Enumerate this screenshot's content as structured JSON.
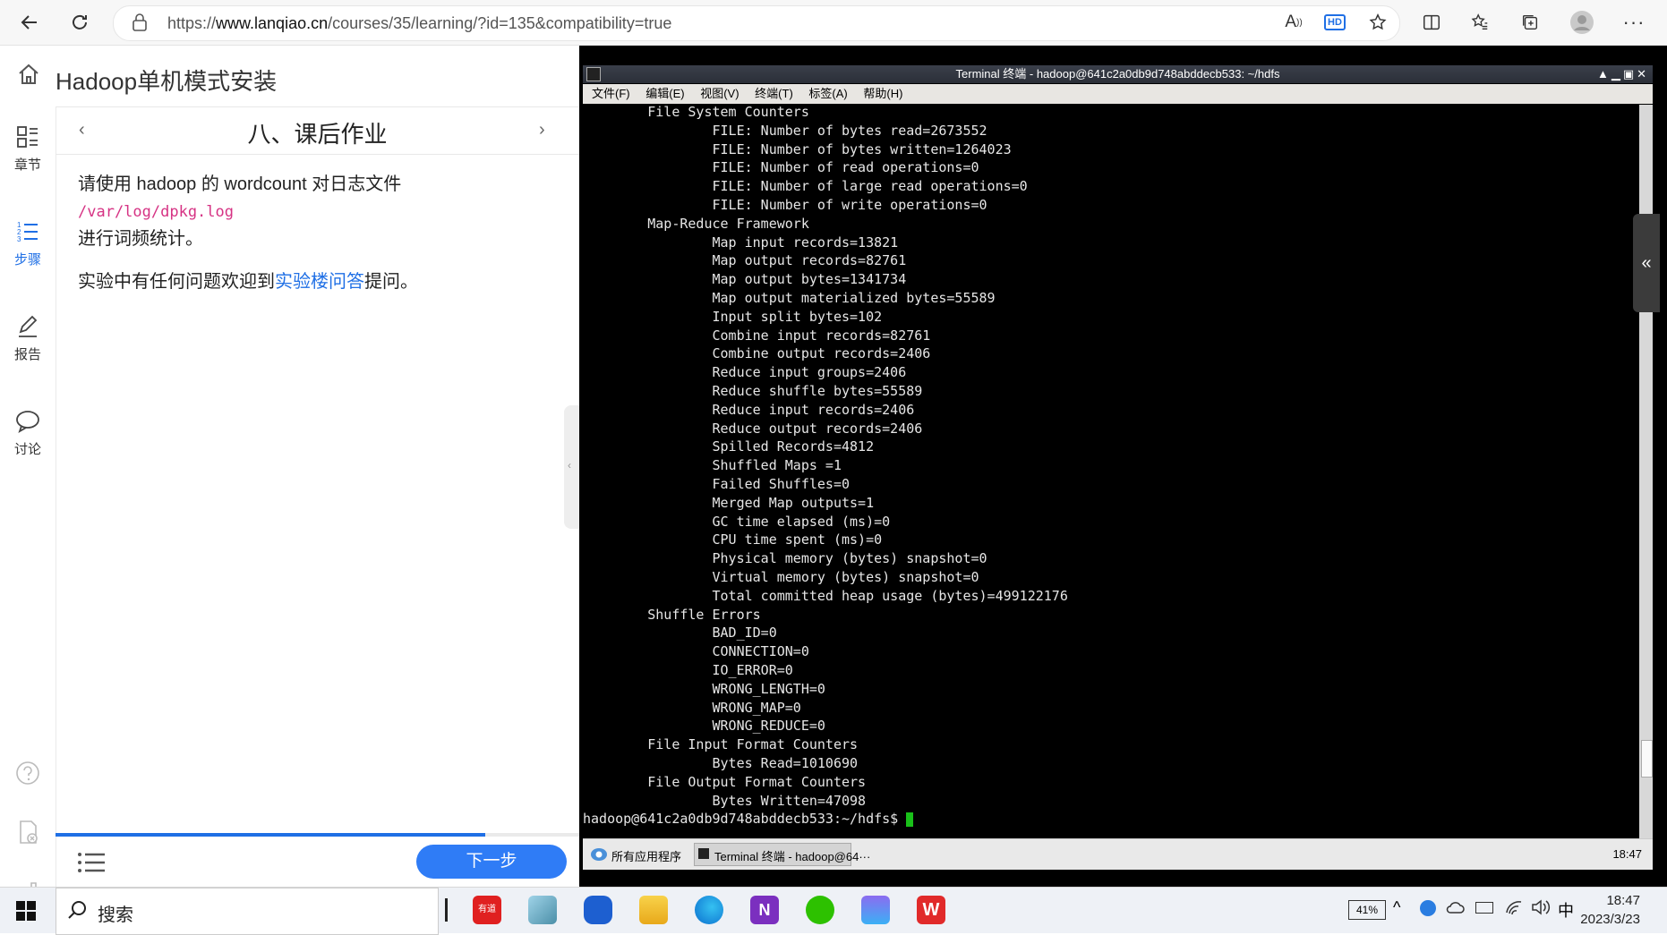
{
  "browser": {
    "url_prefix": "https://",
    "url_host": "www.lanqiao.cn",
    "url_path": "/courses/35/learning/?id=135&compatibility=true",
    "read_aloud": "A",
    "hd_badge": "HD"
  },
  "course": {
    "title": "Hadoop单机模式安装"
  },
  "rail": {
    "items": [
      {
        "label": "章节"
      },
      {
        "label": "步骤"
      },
      {
        "label": "报告"
      },
      {
        "label": "讨论"
      }
    ]
  },
  "step": {
    "title": "八、课后作业",
    "para1_a": "请使用 hadoop 的 wordcount 对日志文件 ",
    "para1_code": "/var/log/dpkg.log",
    "para1_b": "进行词频统计。",
    "para2_a": "实验中有任何问题欢迎到",
    "para2_link": "实验楼问答",
    "para2_b": "提问。",
    "next_label": "下一步",
    "progress_fraction": 0.82
  },
  "terminal": {
    "title": "Terminal 终端 - hadoop@641c2a0db9d748abddecb533: ~/hdfs",
    "menu": [
      "文件(F)",
      "编辑(E)",
      "视图(V)",
      "终端(T)",
      "标签(A)",
      "帮助(H)"
    ],
    "lines": [
      "        File System Counters",
      "                FILE: Number of bytes read=2673552",
      "                FILE: Number of bytes written=1264023",
      "                FILE: Number of read operations=0",
      "                FILE: Number of large read operations=0",
      "                FILE: Number of write operations=0",
      "        Map-Reduce Framework",
      "                Map input records=13821",
      "                Map output records=82761",
      "                Map output bytes=1341734",
      "                Map output materialized bytes=55589",
      "                Input split bytes=102",
      "                Combine input records=82761",
      "                Combine output records=2406",
      "                Reduce input groups=2406",
      "                Reduce shuffle bytes=55589",
      "                Reduce input records=2406",
      "                Reduce output records=2406",
      "                Spilled Records=4812",
      "                Shuffled Maps =1",
      "                Failed Shuffles=0",
      "                Merged Map outputs=1",
      "                GC time elapsed (ms)=0",
      "                CPU time spent (ms)=0",
      "                Physical memory (bytes) snapshot=0",
      "                Virtual memory (bytes) snapshot=0",
      "                Total committed heap usage (bytes)=499122176",
      "        Shuffle Errors",
      "                BAD_ID=0",
      "                CONNECTION=0",
      "                IO_ERROR=0",
      "                WRONG_LENGTH=0",
      "                WRONG_MAP=0",
      "                WRONG_REDUCE=0",
      "        File Input Format Counters",
      "                Bytes Read=1010690",
      "        File Output Format Counters",
      "                Bytes Written=47098"
    ],
    "prompt": "hadoop@641c2a0db9d748abddecb533:~/hdfs$ ",
    "panel_apps": "所有应用程序",
    "panel_task": "Terminal 终端 - hadoop@64···",
    "panel_time": "18:47"
  },
  "taskbar": {
    "search_label": "搜索",
    "battery": "41%",
    "ime": "中",
    "time": "18:47",
    "date": "2023/3/23",
    "app_badge": "有道",
    "colors": {
      "accent": "#1f6fe5",
      "next_button": "#2f7cf6"
    }
  }
}
